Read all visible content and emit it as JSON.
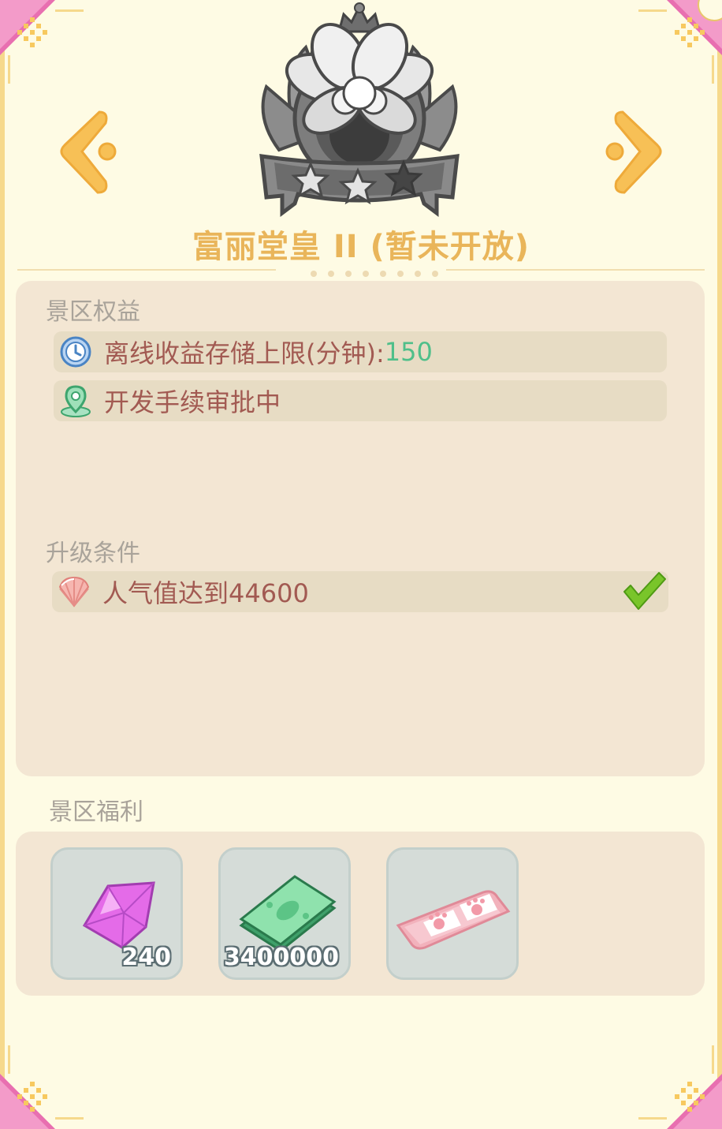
{
  "header": {
    "title": "富丽堂皇 II (暂未开放)",
    "stars_filled": 2,
    "stars_total": 3
  },
  "benefits": {
    "label": "景区权益",
    "offline_storage": {
      "text": "离线收益存储上限(分钟):",
      "value": "150",
      "icon": "clock-icon"
    },
    "permit": {
      "text": "开发手续审批中",
      "icon": "location-pin-icon"
    }
  },
  "upgrade": {
    "label": "升级条件",
    "condition": {
      "text": "人气值达到44600",
      "icon": "shell-icon",
      "completed": true
    }
  },
  "welfare": {
    "label": "景区福利",
    "items": [
      {
        "icon": "diamond-icon",
        "amount": "240"
      },
      {
        "icon": "cash-icon",
        "amount": "3400000"
      },
      {
        "icon": "cat-paw-card-icon",
        "amount": ""
      }
    ]
  },
  "colors": {
    "background": "#fefbe4",
    "title": "#e9b55a",
    "row_text": "#a25a52",
    "value_green": "#4fbf8a",
    "panel": "#f3e6d3",
    "corner_pink": "#e86fb0"
  }
}
